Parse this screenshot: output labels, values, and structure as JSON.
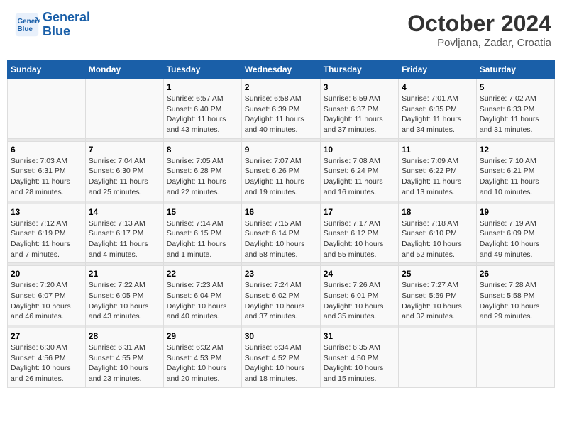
{
  "header": {
    "logo_line1": "General",
    "logo_line2": "Blue",
    "month": "October 2024",
    "location": "Povljana, Zadar, Croatia"
  },
  "days_of_week": [
    "Sunday",
    "Monday",
    "Tuesday",
    "Wednesday",
    "Thursday",
    "Friday",
    "Saturday"
  ],
  "weeks": [
    [
      {
        "day": "",
        "info": ""
      },
      {
        "day": "",
        "info": ""
      },
      {
        "day": "1",
        "info": "Sunrise: 6:57 AM\nSunset: 6:40 PM\nDaylight: 11 hours and 43 minutes."
      },
      {
        "day": "2",
        "info": "Sunrise: 6:58 AM\nSunset: 6:39 PM\nDaylight: 11 hours and 40 minutes."
      },
      {
        "day": "3",
        "info": "Sunrise: 6:59 AM\nSunset: 6:37 PM\nDaylight: 11 hours and 37 minutes."
      },
      {
        "day": "4",
        "info": "Sunrise: 7:01 AM\nSunset: 6:35 PM\nDaylight: 11 hours and 34 minutes."
      },
      {
        "day": "5",
        "info": "Sunrise: 7:02 AM\nSunset: 6:33 PM\nDaylight: 11 hours and 31 minutes."
      }
    ],
    [
      {
        "day": "6",
        "info": "Sunrise: 7:03 AM\nSunset: 6:31 PM\nDaylight: 11 hours and 28 minutes."
      },
      {
        "day": "7",
        "info": "Sunrise: 7:04 AM\nSunset: 6:30 PM\nDaylight: 11 hours and 25 minutes."
      },
      {
        "day": "8",
        "info": "Sunrise: 7:05 AM\nSunset: 6:28 PM\nDaylight: 11 hours and 22 minutes."
      },
      {
        "day": "9",
        "info": "Sunrise: 7:07 AM\nSunset: 6:26 PM\nDaylight: 11 hours and 19 minutes."
      },
      {
        "day": "10",
        "info": "Sunrise: 7:08 AM\nSunset: 6:24 PM\nDaylight: 11 hours and 16 minutes."
      },
      {
        "day": "11",
        "info": "Sunrise: 7:09 AM\nSunset: 6:22 PM\nDaylight: 11 hours and 13 minutes."
      },
      {
        "day": "12",
        "info": "Sunrise: 7:10 AM\nSunset: 6:21 PM\nDaylight: 11 hours and 10 minutes."
      }
    ],
    [
      {
        "day": "13",
        "info": "Sunrise: 7:12 AM\nSunset: 6:19 PM\nDaylight: 11 hours and 7 minutes."
      },
      {
        "day": "14",
        "info": "Sunrise: 7:13 AM\nSunset: 6:17 PM\nDaylight: 11 hours and 4 minutes."
      },
      {
        "day": "15",
        "info": "Sunrise: 7:14 AM\nSunset: 6:15 PM\nDaylight: 11 hours and 1 minute."
      },
      {
        "day": "16",
        "info": "Sunrise: 7:15 AM\nSunset: 6:14 PM\nDaylight: 10 hours and 58 minutes."
      },
      {
        "day": "17",
        "info": "Sunrise: 7:17 AM\nSunset: 6:12 PM\nDaylight: 10 hours and 55 minutes."
      },
      {
        "day": "18",
        "info": "Sunrise: 7:18 AM\nSunset: 6:10 PM\nDaylight: 10 hours and 52 minutes."
      },
      {
        "day": "19",
        "info": "Sunrise: 7:19 AM\nSunset: 6:09 PM\nDaylight: 10 hours and 49 minutes."
      }
    ],
    [
      {
        "day": "20",
        "info": "Sunrise: 7:20 AM\nSunset: 6:07 PM\nDaylight: 10 hours and 46 minutes."
      },
      {
        "day": "21",
        "info": "Sunrise: 7:22 AM\nSunset: 6:05 PM\nDaylight: 10 hours and 43 minutes."
      },
      {
        "day": "22",
        "info": "Sunrise: 7:23 AM\nSunset: 6:04 PM\nDaylight: 10 hours and 40 minutes."
      },
      {
        "day": "23",
        "info": "Sunrise: 7:24 AM\nSunset: 6:02 PM\nDaylight: 10 hours and 37 minutes."
      },
      {
        "day": "24",
        "info": "Sunrise: 7:26 AM\nSunset: 6:01 PM\nDaylight: 10 hours and 35 minutes."
      },
      {
        "day": "25",
        "info": "Sunrise: 7:27 AM\nSunset: 5:59 PM\nDaylight: 10 hours and 32 minutes."
      },
      {
        "day": "26",
        "info": "Sunrise: 7:28 AM\nSunset: 5:58 PM\nDaylight: 10 hours and 29 minutes."
      }
    ],
    [
      {
        "day": "27",
        "info": "Sunrise: 6:30 AM\nSunset: 4:56 PM\nDaylight: 10 hours and 26 minutes."
      },
      {
        "day": "28",
        "info": "Sunrise: 6:31 AM\nSunset: 4:55 PM\nDaylight: 10 hours and 23 minutes."
      },
      {
        "day": "29",
        "info": "Sunrise: 6:32 AM\nSunset: 4:53 PM\nDaylight: 10 hours and 20 minutes."
      },
      {
        "day": "30",
        "info": "Sunrise: 6:34 AM\nSunset: 4:52 PM\nDaylight: 10 hours and 18 minutes."
      },
      {
        "day": "31",
        "info": "Sunrise: 6:35 AM\nSunset: 4:50 PM\nDaylight: 10 hours and 15 minutes."
      },
      {
        "day": "",
        "info": ""
      },
      {
        "day": "",
        "info": ""
      }
    ]
  ]
}
